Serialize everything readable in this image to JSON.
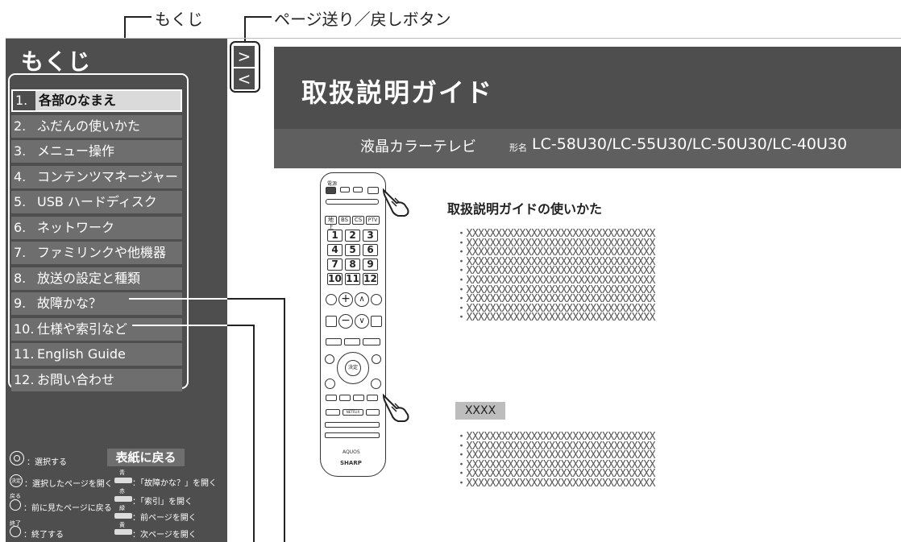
{
  "callouts": {
    "toc": "もくじ",
    "page_nav": "ページ送り／戻しボタン"
  },
  "toc": {
    "title": "もくじ",
    "items": [
      {
        "num": "1.",
        "label": "各部のなまえ"
      },
      {
        "num": "2.",
        "label": "ふだんの使いかた"
      },
      {
        "num": "3.",
        "label": "メニュー操作"
      },
      {
        "num": "4.",
        "label": "コンテンツマネージャー"
      },
      {
        "num": "5.",
        "label": "USB ハードディスク"
      },
      {
        "num": "6.",
        "label": "ネットワーク"
      },
      {
        "num": "7.",
        "label": "ファミリンクや他機器"
      },
      {
        "num": "8.",
        "label": "放送の設定と種類"
      },
      {
        "num": "9.",
        "label": "故障かな？"
      },
      {
        "num": "10.",
        "label": "仕様や索引など"
      },
      {
        "num": "11.",
        "label": "English Guide"
      },
      {
        "num": "12.",
        "label": "お問い合わせ"
      }
    ],
    "active_index": 0
  },
  "legend": {
    "select": "：選択する",
    "back_to_cover": "表紙に戻る",
    "open_selected": "：選択したページを開く",
    "back_label": "戻る",
    "back_prev": "：前に見たページに戻る",
    "end_label": "終了",
    "end": "：終了する",
    "blue_label": "青",
    "blue": "：「故障かな？」を開く",
    "red_label": "赤",
    "red": "：「索引」を開く",
    "green_label": "緑",
    "green": "：前ページを開く",
    "yellow_label": "黄",
    "yellow": "：次ページを開く",
    "enter_key": "決定"
  },
  "nav": {
    "next": ">",
    "prev": "<"
  },
  "header": {
    "title": "取扱説明ガイド",
    "product_type": "液晶カラーテレビ",
    "model_label": "形名",
    "models": "LC-58U30/LC-55U30/LC-50U30/LC-40U30"
  },
  "content": {
    "usage_title": "取扱説明ガイドの使いかた",
    "section1_lines": [
      "・XXXXXXXXXXXXXXXXXXXXXXXXXXXXXXXX",
      "・XXXXXXXXXXXXXXXXXXXXXXXXXXXXXXXX",
      "・XXXXXXXXXXXXXXXXXXXXXXXXXXXXXXXX",
      "・XXXXXXXXXXXXXXXXXXXXXXXXXXXXXXXX",
      "・XXXXXXXXXXXXXXXXXXXXXXXXXXXXXXXX",
      "・XXXXXXXXXXXXXXXXXXXXXXXXXXXXXXXX",
      "・XXXXXXXXXXXXXXXXXXXXXXXXXXXXXXXX",
      "・XXXXXXXXXXXXXXXXXXXXXXXXXXXXXXXX",
      "・XXXXXXXXXXXXXXXXXXXXXXXXXXXXXXXX",
      "・XXXXXXXXXXXXXXXXXXXXXXXXXXXXXXXX"
    ],
    "section2_label": "XXXX",
    "section2_lines": [
      "・XXXXXXXXXXXXXXXXXXXXXXXXXXXXXXXX",
      "・XXXXXXXXXXXXXXXXXXXXXXXXXXXXXXXX",
      "・XXXXXXXXXXXXXXXXXXXXXXXXXXXXXXXX",
      "・XXXXXXXXXXXXXXXXXXXXXXXXXXXXXXXX",
      "・XXXXXXXXXXXXXXXXXXXXXXXXXXXXXXXX",
      "・XXXXXXXXXXXXXXXXXXXXXXXXXXXXXXXX"
    ]
  },
  "remote": {
    "power": "電源",
    "digital": "地上",
    "bs": "BS",
    "cs": "CS",
    "ptv": "PTV",
    "keys": [
      "1",
      "2",
      "3",
      "4",
      "5",
      "6",
      "7",
      "8",
      "9",
      "10",
      "11",
      "12"
    ],
    "enter": "決定",
    "netflix": "NETFLIX",
    "brand": "AQUOS",
    "maker": "SHARP"
  }
}
